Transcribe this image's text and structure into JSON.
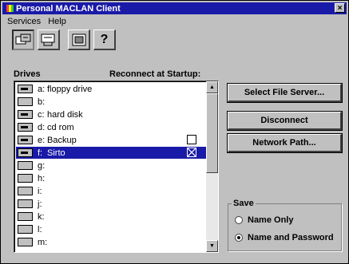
{
  "window": {
    "title": "Personal MACLAN Client",
    "close_label": "×"
  },
  "menu": {
    "items": [
      "Services",
      "Help"
    ]
  },
  "toolbar": {
    "buttons": [
      "drive-connect",
      "drive-disconnect",
      "settings",
      "?"
    ]
  },
  "list": {
    "header_drives": "Drives",
    "header_reconnect": "Reconnect at Startup:",
    "drives": [
      {
        "letter": "a:",
        "name": "floppy drive",
        "icon": "floppy-drive-icon",
        "checkbox": false
      },
      {
        "letter": "b:",
        "name": "",
        "icon": "empty-drive-icon",
        "checkbox": false
      },
      {
        "letter": "c:",
        "name": "hard disk",
        "icon": "hard-disk-icon",
        "checkbox": false
      },
      {
        "letter": "d:",
        "name": "cd rom",
        "icon": "cdrom-icon",
        "checkbox": false
      },
      {
        "letter": "e:",
        "name": "Backup",
        "icon": "network-drive-icon",
        "checkbox": true,
        "checked": false
      },
      {
        "letter": "f:",
        "name": "Sirto",
        "icon": "network-drive-icon",
        "checkbox": true,
        "checked": true,
        "selected": true
      },
      {
        "letter": "g:",
        "name": "",
        "icon": "empty-drive-icon",
        "checkbox": false
      },
      {
        "letter": "h:",
        "name": "",
        "icon": "empty-drive-icon",
        "checkbox": false
      },
      {
        "letter": "i:",
        "name": "",
        "icon": "empty-drive-icon",
        "checkbox": false
      },
      {
        "letter": "j:",
        "name": "",
        "icon": "empty-drive-icon",
        "checkbox": false
      },
      {
        "letter": "k:",
        "name": "",
        "icon": "empty-drive-icon",
        "checkbox": false
      },
      {
        "letter": "l:",
        "name": "",
        "icon": "empty-drive-icon",
        "checkbox": false
      },
      {
        "letter": "m:",
        "name": "",
        "icon": "empty-drive-icon",
        "checkbox": false
      }
    ]
  },
  "buttons": {
    "select_file_server": "Select File Server...",
    "disconnect": "Disconnect",
    "network_path": "Network Path..."
  },
  "save": {
    "label": "Save",
    "options": [
      {
        "label": "Name Only",
        "selected": false
      },
      {
        "label": "Name and Password",
        "selected": true
      }
    ]
  },
  "colors": {
    "selection": "#1a1aa8",
    "face": "#c0c0c0"
  }
}
